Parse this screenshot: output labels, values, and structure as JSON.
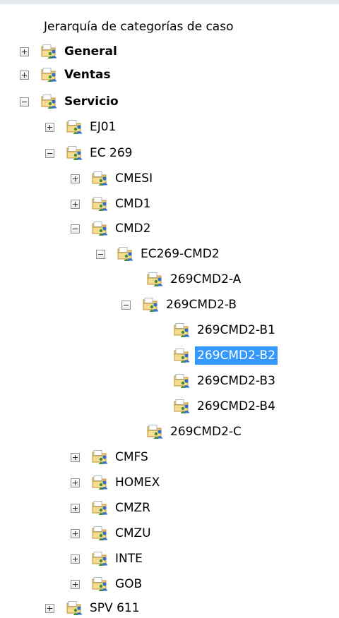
{
  "header": {
    "title": "Jerarquía de categorías de caso"
  },
  "tree": {
    "nodes": [
      {
        "label": "General",
        "bold": true,
        "state": "collapsed"
      },
      {
        "label": "Ventas",
        "bold": true,
        "state": "collapsed"
      },
      {
        "label": "Servicio",
        "bold": true,
        "state": "expanded"
      },
      {
        "label": "EJ01",
        "state": "collapsed"
      },
      {
        "label": "EC 269",
        "state": "expanded"
      },
      {
        "label": "CMESI",
        "state": "collapsed"
      },
      {
        "label": "CMD1",
        "state": "collapsed"
      },
      {
        "label": "CMD2",
        "state": "expanded"
      },
      {
        "label": "EC269-CMD2",
        "state": "expanded"
      },
      {
        "label": "269CMD2-A",
        "state": "leaf"
      },
      {
        "label": "269CMD2-B",
        "state": "expanded"
      },
      {
        "label": "269CMD2-B1",
        "state": "leaf"
      },
      {
        "label": "269CMD2-B2",
        "state": "leaf",
        "selected": true
      },
      {
        "label": "269CMD2-B3",
        "state": "leaf"
      },
      {
        "label": "269CMD2-B4",
        "state": "leaf"
      },
      {
        "label": "269CMD2-C",
        "state": "leaf"
      },
      {
        "label": "CMFS",
        "state": "collapsed"
      },
      {
        "label": "HOMEX",
        "state": "collapsed"
      },
      {
        "label": "CMZR",
        "state": "collapsed"
      },
      {
        "label": "CMZU",
        "state": "collapsed"
      },
      {
        "label": "INTE",
        "state": "collapsed"
      },
      {
        "label": "GOB",
        "state": "collapsed"
      },
      {
        "label": "SPV 611",
        "state": "collapsed"
      }
    ]
  },
  "colors": {
    "selection_bg": "#3399ff",
    "selection_text": "#ffffff",
    "icon_folder": "#f3d27a",
    "icon_person": "#2f6fc9"
  },
  "icons": {
    "toggle_collapsed": "plus-box-icon",
    "toggle_expanded": "minus-box-icon",
    "category": "category-folder-icon"
  }
}
